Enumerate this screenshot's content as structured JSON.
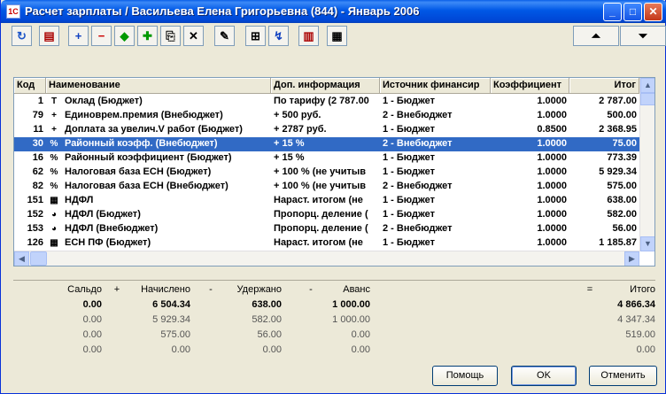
{
  "window": {
    "title": "Расчет зарплаты / Васильева Елена Григорьевна (844) - Январь 2006"
  },
  "toolbar": {
    "icons": [
      "refresh-icon",
      "report-icon",
      "add-icon",
      "remove-icon",
      "diamond-icon",
      "insert-icon",
      "copy-icon",
      "delete-icon",
      "edit-icon",
      "tree-icon",
      "calc-icon",
      "calculator-icon",
      "table-icon",
      "move-up-icon",
      "move-down-icon"
    ]
  },
  "grid": {
    "columns": [
      "Код",
      "Наименование",
      "Доп. информация",
      "Источник финансир",
      "Коэффициент",
      "Итог"
    ],
    "rows": [
      {
        "code": "1",
        "icon": "T",
        "name": "Оклад (Бюджет)",
        "info": "По тарифу (2 787.00",
        "source": "1 - Бюджет",
        "coef": "1.0000",
        "total": "2 787.00"
      },
      {
        "code": "79",
        "icon": "+",
        "name": "Единоврем.премия (Внебюджет)",
        "info": "+ 500 руб.",
        "source": "2 - Внебюджет",
        "coef": "1.0000",
        "total": "500.00"
      },
      {
        "code": "11",
        "icon": "+",
        "name": "Доплата за увелич.V работ (Бюджет)",
        "info": "+ 2787 руб.",
        "source": "1 - Бюджет",
        "coef": "0.8500",
        "total": "2 368.95"
      },
      {
        "code": "30",
        "icon": "%",
        "name": "Районный коэфф. (Внебюджет)",
        "info": "+ 15 %",
        "source": "2 - Внебюджет",
        "coef": "1.0000",
        "total": "75.00",
        "selected": true
      },
      {
        "code": "16",
        "icon": "%",
        "name": "Районный коэффициент (Бюджет)",
        "info": "+ 15 %",
        "source": "1 - Бюджет",
        "coef": "1.0000",
        "total": "773.39"
      },
      {
        "code": "62",
        "icon": "%",
        "name": "Налоговая база ЕСН (Бюджет)",
        "info": "+ 100 % (не учитыв",
        "source": "1 - Бюджет",
        "coef": "1.0000",
        "total": "5 929.34"
      },
      {
        "code": "82",
        "icon": "%",
        "name": "Налоговая база ЕСН (Внебюджет)",
        "info": "+ 100 % (не учитыв",
        "source": "2 - Внебюджет",
        "coef": "1.0000",
        "total": "575.00"
      },
      {
        "code": "151",
        "icon": "▦",
        "name": "НДФЛ",
        "info": "Нараст. итогом (не",
        "source": "1 - Бюджет",
        "coef": "1.0000",
        "total": "638.00"
      },
      {
        "code": "152",
        "icon": "◕",
        "name": "НДФЛ (Бюджет)",
        "info": "Пропорц. деление (",
        "source": "1 - Бюджет",
        "coef": "1.0000",
        "total": "582.00"
      },
      {
        "code": "153",
        "icon": "◕",
        "name": "НДФЛ (Внебюджет)",
        "info": "Пропорц. деление (",
        "source": "2 - Внебюджет",
        "coef": "1.0000",
        "total": "56.00"
      },
      {
        "code": "126",
        "icon": "▦",
        "name": "ЕСН ПФ (Бюджет)",
        "info": "Нараст. итогом (не",
        "source": "1 - Бюджет",
        "coef": "1.0000",
        "total": "1 185.87"
      }
    ]
  },
  "summary": {
    "labels": {
      "saldo": "Сальдо",
      "plus": "+",
      "accrued": "Начислено",
      "minus1": "-",
      "withheld": "Удержано",
      "minus2": "-",
      "advance": "Аванс",
      "eq": "=",
      "total": "Итого"
    },
    "rows": [
      {
        "saldo": "0.00",
        "accrued": "6 504.34",
        "withheld": "638.00",
        "advance": "1 000.00",
        "total": "4 866.34"
      },
      {
        "saldo": "0.00",
        "accrued": "5 929.34",
        "withheld": "582.00",
        "advance": "1 000.00",
        "total": "4 347.34"
      },
      {
        "saldo": "0.00",
        "accrued": "575.00",
        "withheld": "56.00",
        "advance": "0.00",
        "total": "519.00"
      },
      {
        "saldo": "0.00",
        "accrued": "0.00",
        "withheld": "0.00",
        "advance": "0.00",
        "total": "0.00"
      }
    ]
  },
  "buttons": {
    "help": "Помощь",
    "ok": "OK",
    "cancel": "Отменить"
  }
}
